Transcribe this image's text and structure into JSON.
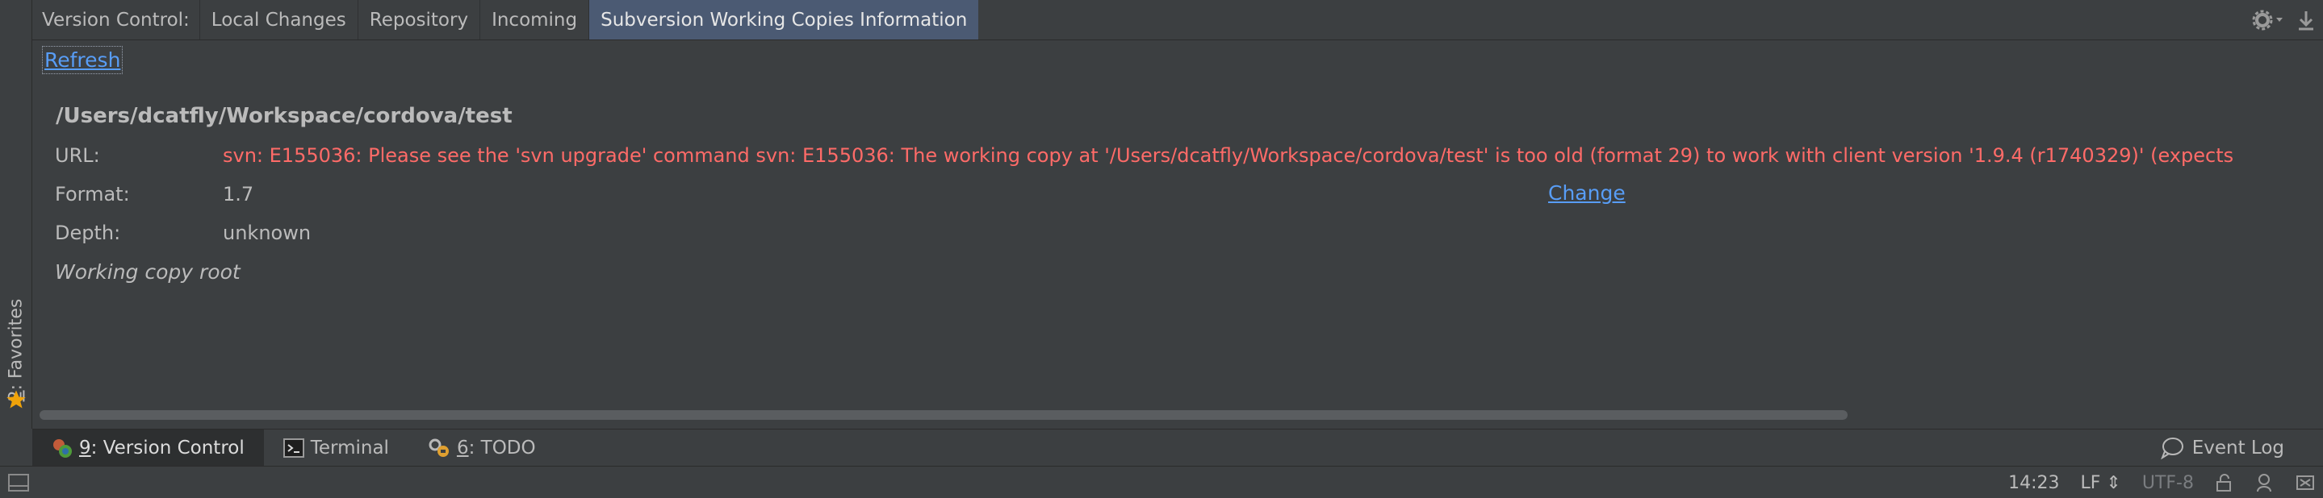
{
  "tabs": {
    "title": "Version Control:",
    "items": [
      {
        "label": "Local Changes"
      },
      {
        "label": "Repository"
      },
      {
        "label": "Incoming"
      },
      {
        "label": "Subversion Working Copies Information",
        "active": true
      }
    ]
  },
  "sidebar": {
    "favorites_number": "2",
    "favorites_label": ": Favorites"
  },
  "main": {
    "refresh_label": "Refresh",
    "path": "/Users/dcatfly/Workspace/cordova/test",
    "url_label": "URL:",
    "url_value": "svn: E155036: Please see the 'svn upgrade' command svn: E155036: The working copy at '/Users/dcatfly/Workspace/cordova/test' is too old (format 29) to work with client version '1.9.4 (r1740329)' (expects",
    "format_label": "Format:",
    "format_value": "1.7",
    "change_label": "Change",
    "depth_label": "Depth:",
    "depth_value": "unknown",
    "root_label": "Working copy root"
  },
  "toolwindows": {
    "vc_number": "9",
    "vc_label": ": Version Control",
    "terminal_label": "Terminal",
    "todo_number": "6",
    "todo_label": ": TODO",
    "event_log_label": "Event Log"
  },
  "statusbar": {
    "time": "14:23",
    "line_sep": "LF",
    "encoding": "UTF-8"
  },
  "colors": {
    "background": "#3c3f41",
    "active_tab": "#4b5a73",
    "link": "#589df6",
    "error": "#ff6b68",
    "text": "#bbbbbb"
  }
}
